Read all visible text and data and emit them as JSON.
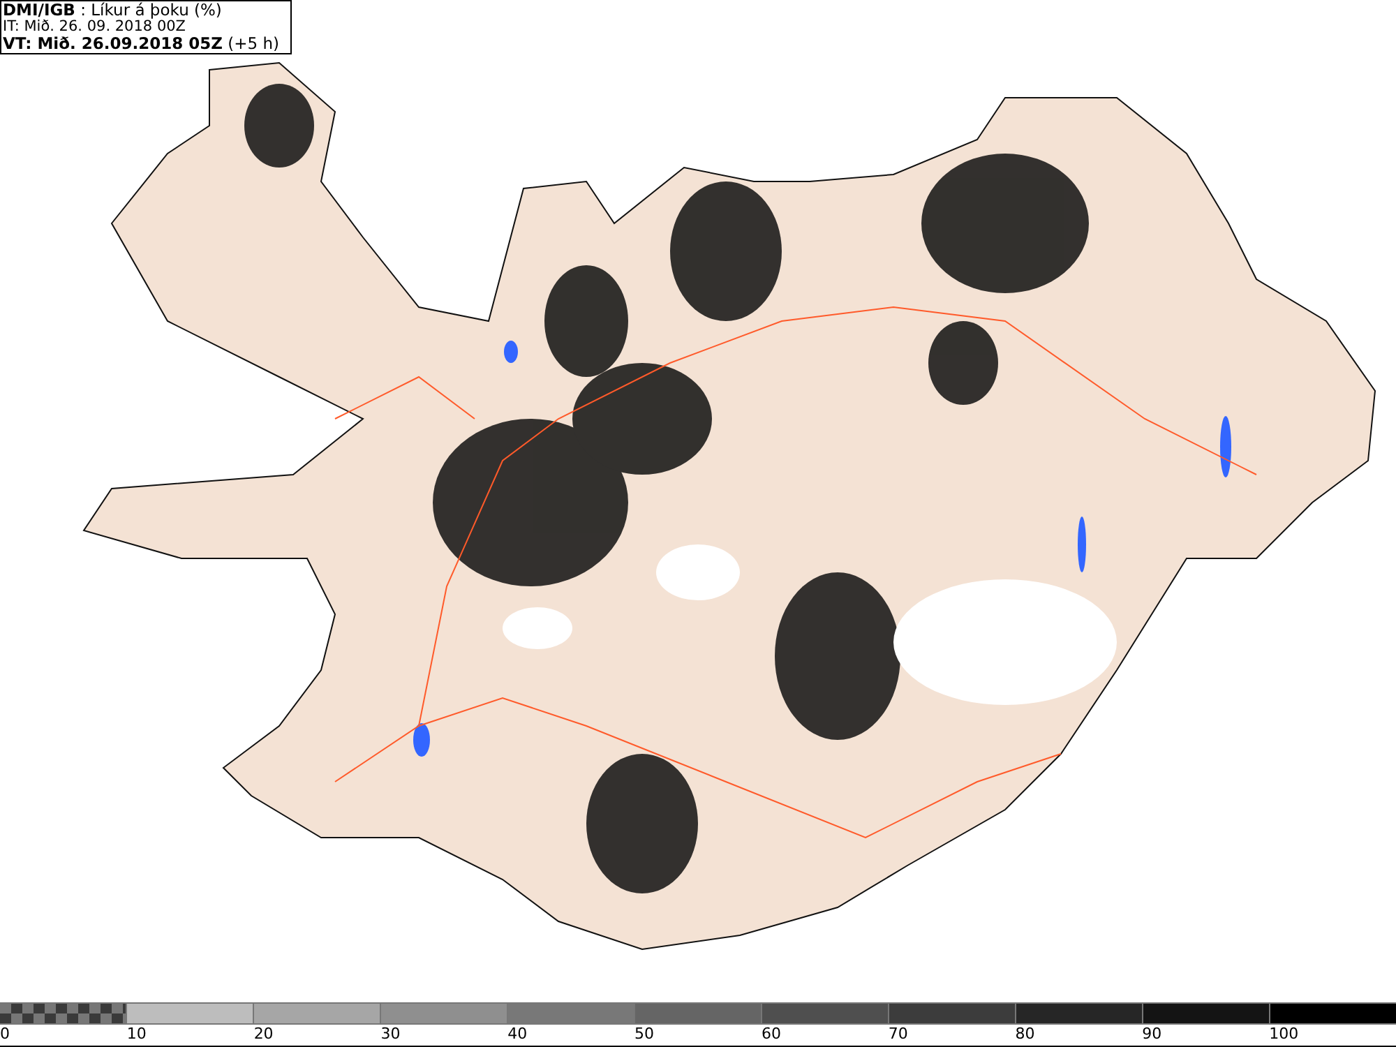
{
  "header": {
    "lines": [
      "**DMI/IGB** : Líkur á þoku (%)",
      "IT: Mið. 26. 09. 2018 00Z",
      "**VT: Mið. 26.09.2018 05Z** (+5 h)"
    ]
  },
  "legend": {
    "segments": [
      {
        "kind": "checker",
        "color": "#3a3a3a"
      },
      {
        "kind": "solid",
        "color": "#bdbdbd"
      },
      {
        "kind": "solid",
        "color": "#a6a6a6"
      },
      {
        "kind": "solid",
        "color": "#8f8f8f"
      },
      {
        "kind": "solid",
        "color": "#787878"
      },
      {
        "kind": "solid",
        "color": "#656565"
      },
      {
        "kind": "solid",
        "color": "#4f4f4f"
      },
      {
        "kind": "solid",
        "color": "#3c3c3c"
      },
      {
        "kind": "solid",
        "color": "#262626"
      },
      {
        "kind": "solid",
        "color": "#141414"
      },
      {
        "kind": "solid",
        "color": "#000000"
      }
    ],
    "ticks": [
      "0",
      "10",
      "20",
      "30",
      "40",
      "50",
      "60",
      "70",
      "80",
      "90",
      "100"
    ]
  }
}
